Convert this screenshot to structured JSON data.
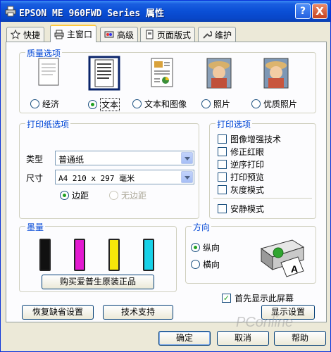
{
  "window": {
    "title": "EPSON ME 960FWD Series 属性",
    "help_symbol": "?",
    "close_symbol": "X"
  },
  "tabs": [
    {
      "label": "快捷"
    },
    {
      "label": "主窗口"
    },
    {
      "label": "高级"
    },
    {
      "label": "页面版式"
    },
    {
      "label": "维护"
    }
  ],
  "quality": {
    "legend": "质量选项",
    "options": [
      {
        "label": "经济",
        "selected": false
      },
      {
        "label": "文本",
        "selected": true
      },
      {
        "label": "文本和图像",
        "selected": false
      },
      {
        "label": "照片",
        "selected": false
      },
      {
        "label": "优质照片",
        "selected": false
      }
    ]
  },
  "paper": {
    "legend": "打印纸选项",
    "type_label": "类型",
    "type_value": "普通纸",
    "size_label": "尺寸",
    "size_value": "A4 210 x 297 毫米",
    "margin_options": [
      {
        "label": "边距",
        "selected": true
      },
      {
        "label": "无边距",
        "selected": false,
        "disabled": true
      }
    ]
  },
  "print_options": {
    "legend": "打印选项",
    "items": [
      {
        "label": "图像增强技术",
        "checked": false
      },
      {
        "label": "修正红眼",
        "checked": false
      },
      {
        "label": "逆序打印",
        "checked": false
      },
      {
        "label": "打印预览",
        "checked": false
      },
      {
        "label": "灰度模式",
        "checked": false
      }
    ],
    "quiet_mode": {
      "label": "安静模式",
      "checked": false
    }
  },
  "ink": {
    "legend": "墨量",
    "cartridge_colors": [
      "#111111",
      "#e31ad0",
      "#f5e60a",
      "#18d2e8"
    ],
    "buy_button": "购买爱普生原装正品"
  },
  "orientation": {
    "legend": "方向",
    "options": [
      {
        "label": "纵向",
        "selected": true
      },
      {
        "label": "横向",
        "selected": false
      }
    ],
    "preview_letter": "A"
  },
  "show_first": {
    "label": "首先显示此屏幕",
    "checked": true,
    "mark": "✓"
  },
  "buttons": {
    "restore": "恢复缺省设置",
    "support": "技术支持",
    "display": "显示设置",
    "ok": "确定",
    "cancel": "取消",
    "help": "帮助"
  },
  "watermark": "PConline"
}
